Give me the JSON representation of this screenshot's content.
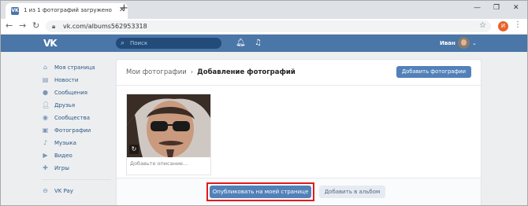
{
  "browser": {
    "tab_title": "1 из 1 фотографий загружено",
    "tab_favicon": "VK",
    "url": "vk.com/albums562953318",
    "profile_initial": "И"
  },
  "header": {
    "logo": "VK",
    "search_placeholder": "Поиск",
    "user_name": "Иван"
  },
  "sidebar": {
    "items": [
      {
        "label": "Моя страница",
        "icon": "home-icon"
      },
      {
        "label": "Новости",
        "icon": "news-icon"
      },
      {
        "label": "Сообщения",
        "icon": "messages-icon"
      },
      {
        "label": "Друзья",
        "icon": "friends-icon"
      },
      {
        "label": "Сообщества",
        "icon": "communities-icon"
      },
      {
        "label": "Фотографии",
        "icon": "photos-icon"
      },
      {
        "label": "Музыка",
        "icon": "music-icon"
      },
      {
        "label": "Видео",
        "icon": "video-icon"
      },
      {
        "label": "Игры",
        "icon": "games-icon"
      }
    ],
    "vkpay": {
      "label": "VK Pay",
      "icon": "vkpay-icon"
    }
  },
  "main": {
    "breadcrumb_parent": "Мои фотографии",
    "breadcrumb_current": "Добавление фотографий",
    "add_button": "Добавить фотографии",
    "photo_description_placeholder": "Добавьте описание...",
    "publish_button": "Опубликовать на моей странице",
    "album_button": "Добавить в альбом"
  },
  "colors": {
    "vk_blue": "#4a76a8",
    "button_blue": "#5181b8",
    "highlight_red": "#e21b1b"
  }
}
